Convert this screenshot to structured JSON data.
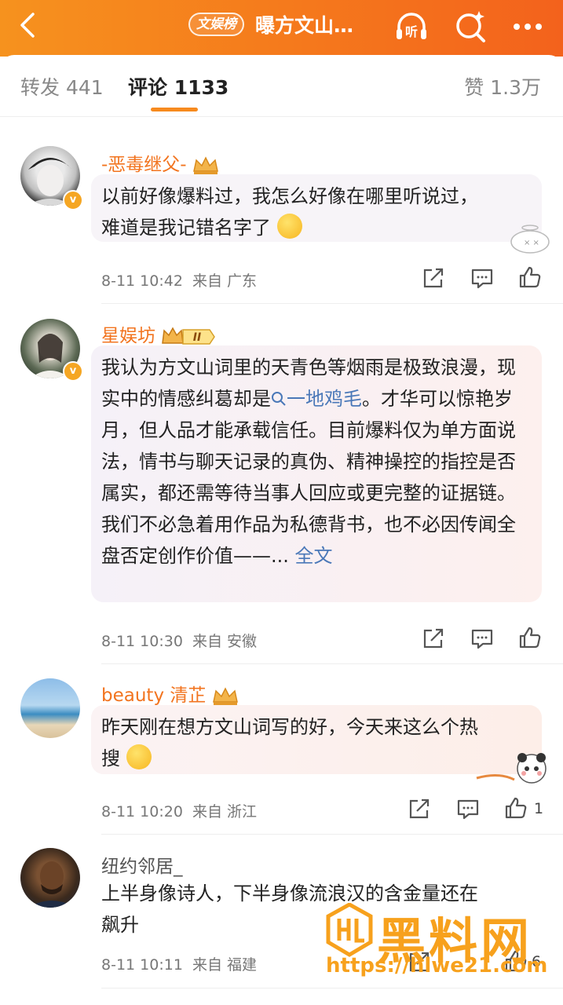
{
  "header": {
    "badge": "文娱榜",
    "title": "曝方文山…",
    "icons": [
      "back-arrow-icon",
      "listen-icon",
      "search-sparkle-icon",
      "more-icon"
    ],
    "listen_label": "听",
    "colors": {
      "bar_start": "#f6921e",
      "bar_end": "#f3621c"
    }
  },
  "tabs": {
    "repost": "转发 441",
    "comment": "评论 1133",
    "like": "赞 1.3万"
  },
  "comments": [
    {
      "name": "-恶毒继父-",
      "text_line1": "以前好像爆料过，我怎么好像在哪里听说过，",
      "text_line2": "难道是我记错名字了",
      "time": "8-11 10:42",
      "from": "来自 广东"
    },
    {
      "name": "星娱坊",
      "level_badge": "II",
      "text_before_link": "我认为方文山词里的天青色等烟雨是极致浪漫，现实中的情感纠葛却是",
      "link": "一地鸡毛",
      "text_after_link": "。才华可以惊艳岁月，但人品才能承载信任。目前爆料仅为单方面说法，情书与聊天记录的真伪、精神操控的指控是否属实，都还需等待当事人回应或更完整的证据链。我们不必急着用作品为私德背书，也不必因传闻全盘否定创作价值——...",
      "full_text": "全文",
      "time": "8-11 10:30",
      "from": "来自 安徽"
    },
    {
      "name": "beauty 清芷",
      "text_line1": "昨天刚在想方文山词写的好，今天来这么个热",
      "text_line2": "搜",
      "time": "8-11 10:20",
      "from": "来自 浙江",
      "likes": "1"
    },
    {
      "name": "纽约邻居_",
      "text_line1": "上半身像诗人，下半身像流浪汉的含金量还在",
      "text_line2": "飙升",
      "time": "8-11 10:11",
      "from": "来自 福建",
      "likes": "6"
    }
  ],
  "watermark": {
    "brand": "黑料网",
    "url": "https://hlwe21.com"
  }
}
